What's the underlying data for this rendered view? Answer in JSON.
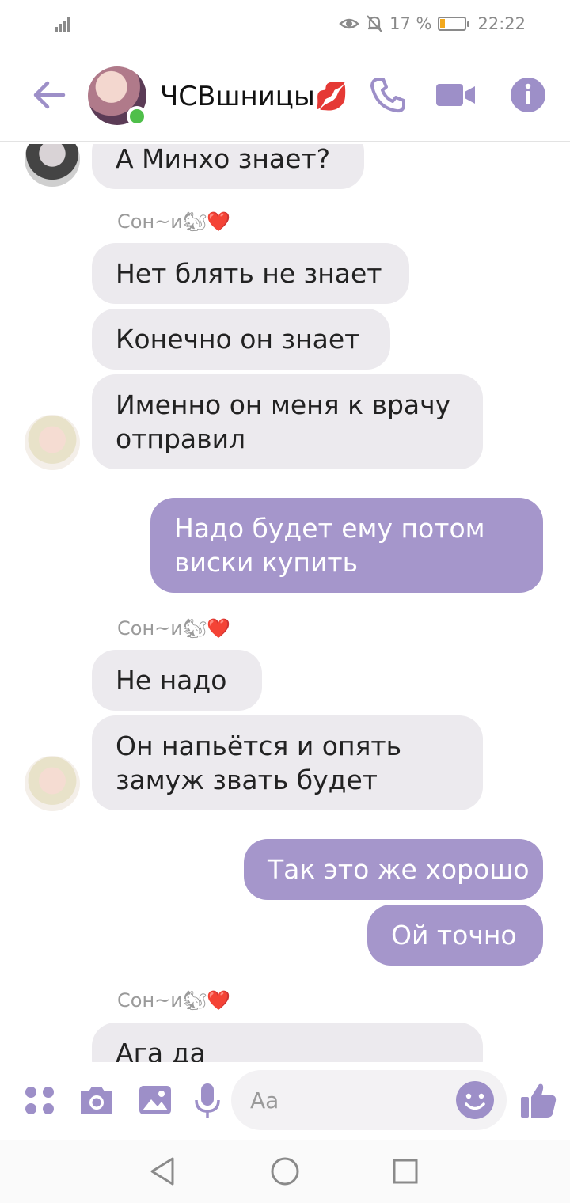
{
  "status_bar": {
    "battery_text": "17 %",
    "battery_level": 0.17,
    "time": "22:22",
    "icons": [
      "signal-icon",
      "eye-icon",
      "bell-off-icon",
      "battery-icon"
    ]
  },
  "header": {
    "title": "ЧСВшницы💋",
    "back_icon": "arrow-left-icon",
    "call_icon": "phone-icon",
    "video_icon": "video-camera-icon",
    "info_icon": "info-icon",
    "accent": "#a596cb"
  },
  "messages": {
    "m1": "А Минхо знает?",
    "sender1": "Сон~и🐿❤️",
    "m2": "Нет блять не знает",
    "m3": "Конечно он знает",
    "m4_line1": "Именно он меня к врачу",
    "m4_line2": "отправил",
    "m5_line1": "Надо будет ему потом",
    "m5_line2": "виски купить",
    "sender2": "Сон~и🐿❤️",
    "m6": "Не надо",
    "m7_line1": "Он напьётся и опять",
    "m7_line2": "замуж звать будет",
    "m8": "Так это же хорошо",
    "m9": "Ой точно",
    "sender3": "Сон~и🐿❤️",
    "m10": "Ага да"
  },
  "composer": {
    "placeholder": "Aa",
    "icons": [
      "apps-icon",
      "camera-icon",
      "gallery-icon",
      "microphone-icon",
      "emoji-icon",
      "thumbs-up-icon"
    ]
  },
  "colors": {
    "incoming_bubble": "#eceaee",
    "outgoing_bubble": "#a596cb",
    "icon_purple": "#9d8fc8"
  }
}
